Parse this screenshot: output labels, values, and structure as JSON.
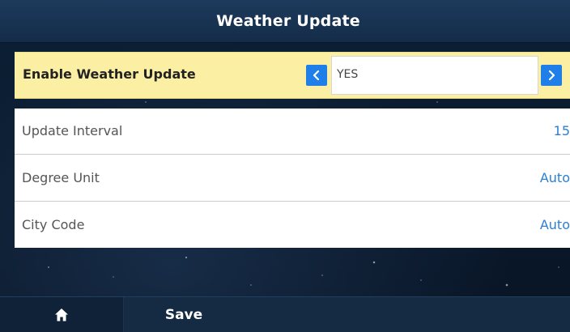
{
  "header": {
    "title": "Weather Update"
  },
  "enable_row": {
    "label": "Enable Weather Update",
    "value": "YES",
    "prev_icon": "chevron-left-icon",
    "next_icon": "chevron-right-icon"
  },
  "settings": [
    {
      "label": "Update Interval",
      "value": "15"
    },
    {
      "label": "Degree Unit",
      "value": "Auto"
    },
    {
      "label": "City Code",
      "value": "Auto"
    }
  ],
  "footer": {
    "home_icon": "home-icon",
    "save_label": "Save"
  },
  "colors": {
    "highlight_row": "#fbefa4",
    "accent_blue": "#1f7ee8",
    "value_text": "#2a7fd8",
    "title_bar": "#1d3a5c"
  }
}
